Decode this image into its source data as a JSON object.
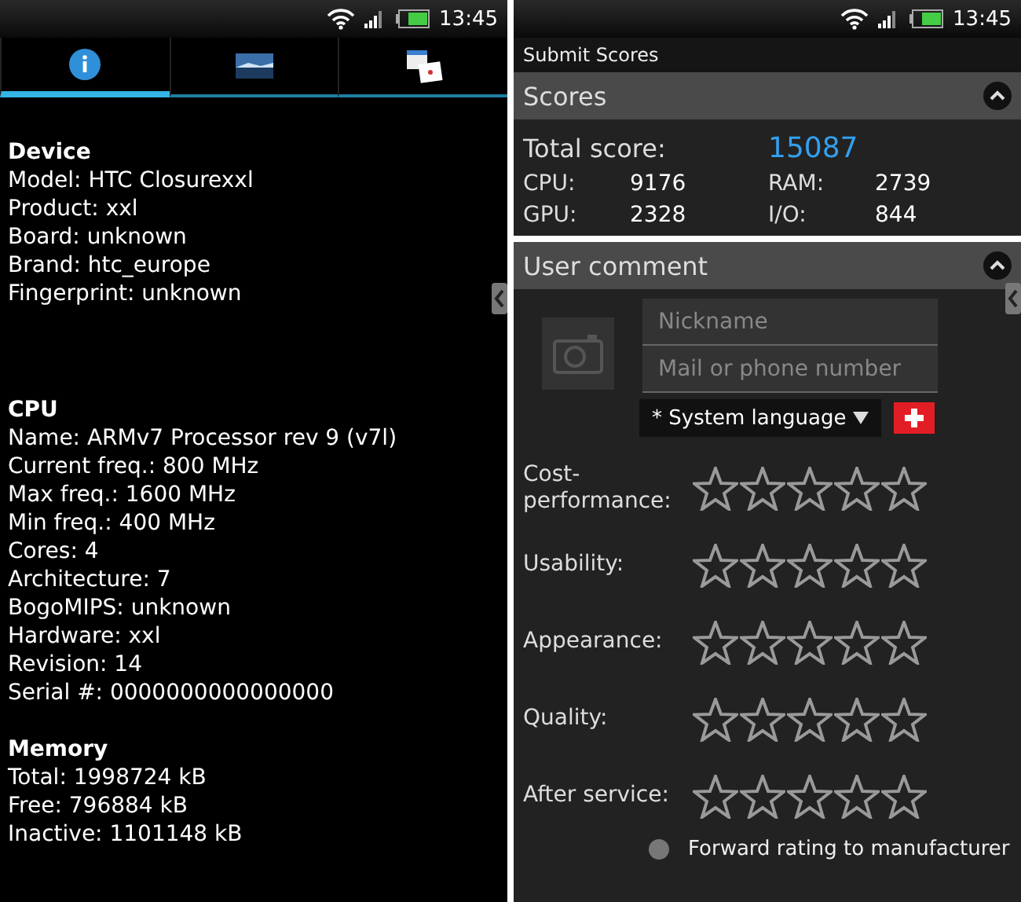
{
  "left_screen": {
    "status_bar": {
      "time": "13:45"
    },
    "tabs": [
      {
        "kind": "info",
        "selected": true
      },
      {
        "kind": "picture",
        "selected": false
      },
      {
        "kind": "cards",
        "selected": false
      }
    ],
    "sections": [
      {
        "title": "Device",
        "lines": [
          "Model: HTC Closurexxl",
          "Product: xxl",
          "Board: unknown",
          "Brand: htc_europe",
          "Fingerprint: unknown"
        ]
      },
      {
        "title": "CPU",
        "lines": [
          "Name: ARMv7 Processor rev 9 (v7l)",
          "Current freq.: 800 MHz",
          "Max freq.: 1600 MHz",
          "Min freq.: 400 MHz",
          "Cores: 4",
          "Architecture: 7",
          "BogoMIPS: unknown",
          "Hardware: xxl",
          "Revision: 14",
          "Serial #: 0000000000000000"
        ]
      },
      {
        "title": "Memory",
        "lines": [
          "Total: 1998724 kB",
          "Free: 796884 kB",
          "Inactive: 1101148 kB"
        ]
      }
    ]
  },
  "right_screen": {
    "status_bar": {
      "time": "13:45"
    },
    "title": "Submit Scores",
    "scores": {
      "title": "Scores",
      "expanded": true,
      "total_label": "Total score:",
      "total_value": "15087",
      "items": [
        {
          "label": "CPU:",
          "value": "9176"
        },
        {
          "label": "RAM:",
          "value": "2739"
        },
        {
          "label": "GPU:",
          "value": "2328"
        },
        {
          "label": "I/O:",
          "value": "844"
        }
      ]
    },
    "comment": {
      "title": "User comment",
      "expanded": true,
      "nickname_placeholder": "Nickname",
      "contact_placeholder": "Mail or phone number",
      "language": "* System language",
      "ratings": [
        {
          "label": "Cost-performance:",
          "stars": 0
        },
        {
          "label": "Usability:",
          "stars": 0
        },
        {
          "label": "Appearance:",
          "stars": 0
        },
        {
          "label": "Quality:",
          "stars": 0
        },
        {
          "label": "After service:",
          "stars": 0
        }
      ],
      "forward": {
        "label": "Forward rating to manufacturer",
        "checked": false
      }
    }
  }
}
